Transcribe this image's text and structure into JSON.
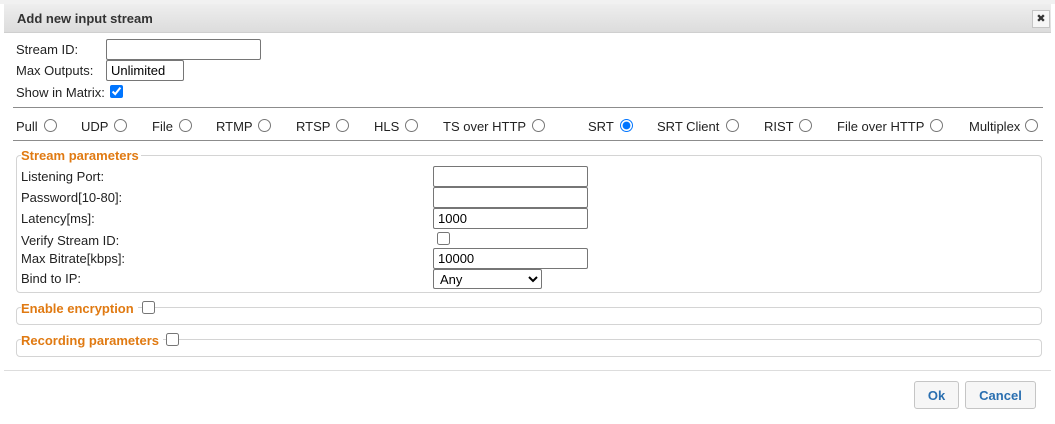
{
  "dialog": {
    "title": "Add new input stream",
    "close_glyph": "✖"
  },
  "general": {
    "stream_id_label": "Stream ID:",
    "stream_id_value": "",
    "max_outputs_label": "Max Outputs:",
    "max_outputs_value": "Unlimited",
    "show_in_matrix_label": "Show in Matrix:",
    "show_in_matrix_checked": true
  },
  "stream_types": [
    {
      "label": "Pull",
      "selected": false
    },
    {
      "label": "UDP",
      "selected": false
    },
    {
      "label": "File",
      "selected": false
    },
    {
      "label": "RTMP",
      "selected": false
    },
    {
      "label": "RTSP",
      "selected": false
    },
    {
      "label": "HLS",
      "selected": false
    },
    {
      "label": "TS over HTTP",
      "selected": false
    },
    {
      "label": "SRT",
      "selected": true
    },
    {
      "label": "SRT Client",
      "selected": false
    },
    {
      "label": "RIST",
      "selected": false
    },
    {
      "label": "File over HTTP",
      "selected": false
    },
    {
      "label": "Multiplex",
      "selected": false
    }
  ],
  "stream_parameters": {
    "legend": "Stream parameters",
    "listening_port_label": "Listening Port:",
    "listening_port_value": "",
    "password_label": "Password[10-80]:",
    "password_value": "",
    "latency_label": "Latency[ms]:",
    "latency_value": "1000",
    "verify_stream_id_label": "Verify Stream ID:",
    "verify_stream_id_checked": false,
    "max_bitrate_label": "Max Bitrate[kbps]:",
    "max_bitrate_value": "10000",
    "bind_to_ip_label": "Bind to IP:",
    "bind_to_ip_value": "Any"
  },
  "encryption": {
    "legend": "Enable encryption",
    "checked": false
  },
  "recording": {
    "legend": "Recording parameters",
    "checked": false
  },
  "buttons": {
    "ok_label": "Ok",
    "cancel_label": "Cancel"
  },
  "colors": {
    "legend_accent": "#e07a12",
    "button_text": "#2a6fb0"
  }
}
